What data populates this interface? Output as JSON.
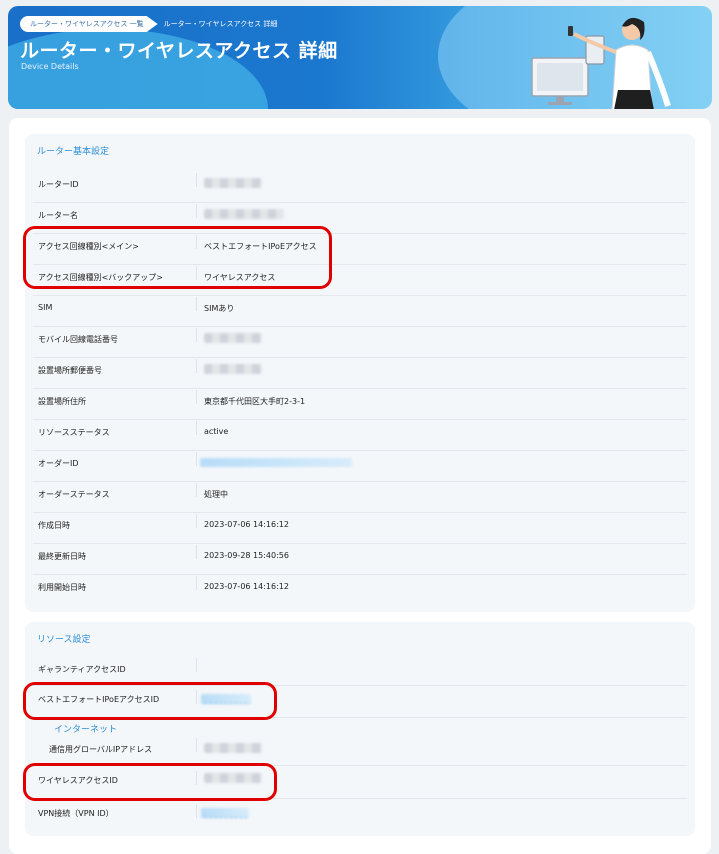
{
  "breadcrumb": {
    "parent": "ルーター・ワイヤレスアクセス 一覧",
    "current": "ルーター・ワイヤレスアクセス 詳細"
  },
  "page": {
    "title": "ルーター・ワイヤレスアクセス 詳細",
    "subtitle": "Device Details"
  },
  "basic": {
    "title": "ルーター基本設定",
    "rows": [
      {
        "label": "ルーターID",
        "value": ""
      },
      {
        "label": "ルーター名",
        "value": ""
      },
      {
        "label": "アクセス回線種別<メイン>",
        "value": "ベストエフォートIPoEアクセス"
      },
      {
        "label": "アクセス回線種別<バックアップ>",
        "value": "ワイヤレスアクセス"
      },
      {
        "label": "SIM",
        "value": "SIMあり"
      },
      {
        "label": "モバイル回線電話番号",
        "value": ""
      },
      {
        "label": "設置場所郵便番号",
        "value": ""
      },
      {
        "label": "設置場所住所",
        "value": "東京都千代田区大手町2-3-1"
      },
      {
        "label": "リソースステータス",
        "value": "active"
      },
      {
        "label": "オーダーID",
        "value": ""
      },
      {
        "label": "オーダーステータス",
        "value": "処理中"
      },
      {
        "label": "作成日時",
        "value": "2023-07-06 14:16:12"
      },
      {
        "label": "最終更新日時",
        "value": "2023-09-28 15:40:56"
      },
      {
        "label": "利用開始日時",
        "value": "2023-07-06 14:16:12"
      }
    ]
  },
  "resource": {
    "title": "リソース設定",
    "guarantee_label": "ギャランティアクセスID",
    "besteffort_label": "ベストエフォートIPoEアクセスID",
    "internet_label": "インターネット",
    "global_ip_label": "通信用グローバルIPアドレス",
    "wireless_label": "ワイヤレスアクセスID",
    "vpn_label": "VPN接続（VPN ID）"
  },
  "colors": {
    "accent": "#2b8ed6",
    "highlight": "#e00000",
    "header_start": "#1a6fc8",
    "header_end": "#6ec7ef"
  }
}
